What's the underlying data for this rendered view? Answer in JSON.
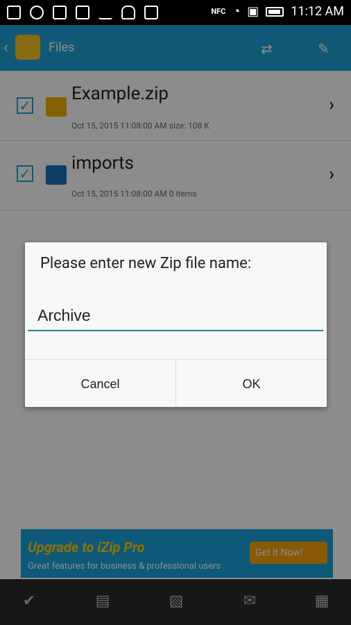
{
  "status_bar": {
    "time": "11:12 AM",
    "nfc_label": "NFC"
  },
  "app_bar": {
    "title": "Files"
  },
  "files": [
    {
      "name": "Example.zip",
      "meta": "Oct 15, 2015 11:08:00 AM   size: 108 K",
      "checked": true,
      "type": "zip",
      "icon_color": "#f2b000"
    },
    {
      "name": "imports",
      "meta": "Oct 15, 2015 11:08:00 AM   0 items",
      "checked": true,
      "type": "folder",
      "icon_color": "#1a6fb5"
    }
  ],
  "banner": {
    "title": "Upgrade to  iZip Pro",
    "subtitle": "Great features for business & professional users",
    "button_label": "Get it Now!"
  },
  "dialog": {
    "message": "Please enter new Zip file name:",
    "input_value": "Archive",
    "cancel_label": "Cancel",
    "ok_label": "OK"
  },
  "colors": {
    "accent": "#1fa0d8",
    "input_underline": "#168a96"
  }
}
